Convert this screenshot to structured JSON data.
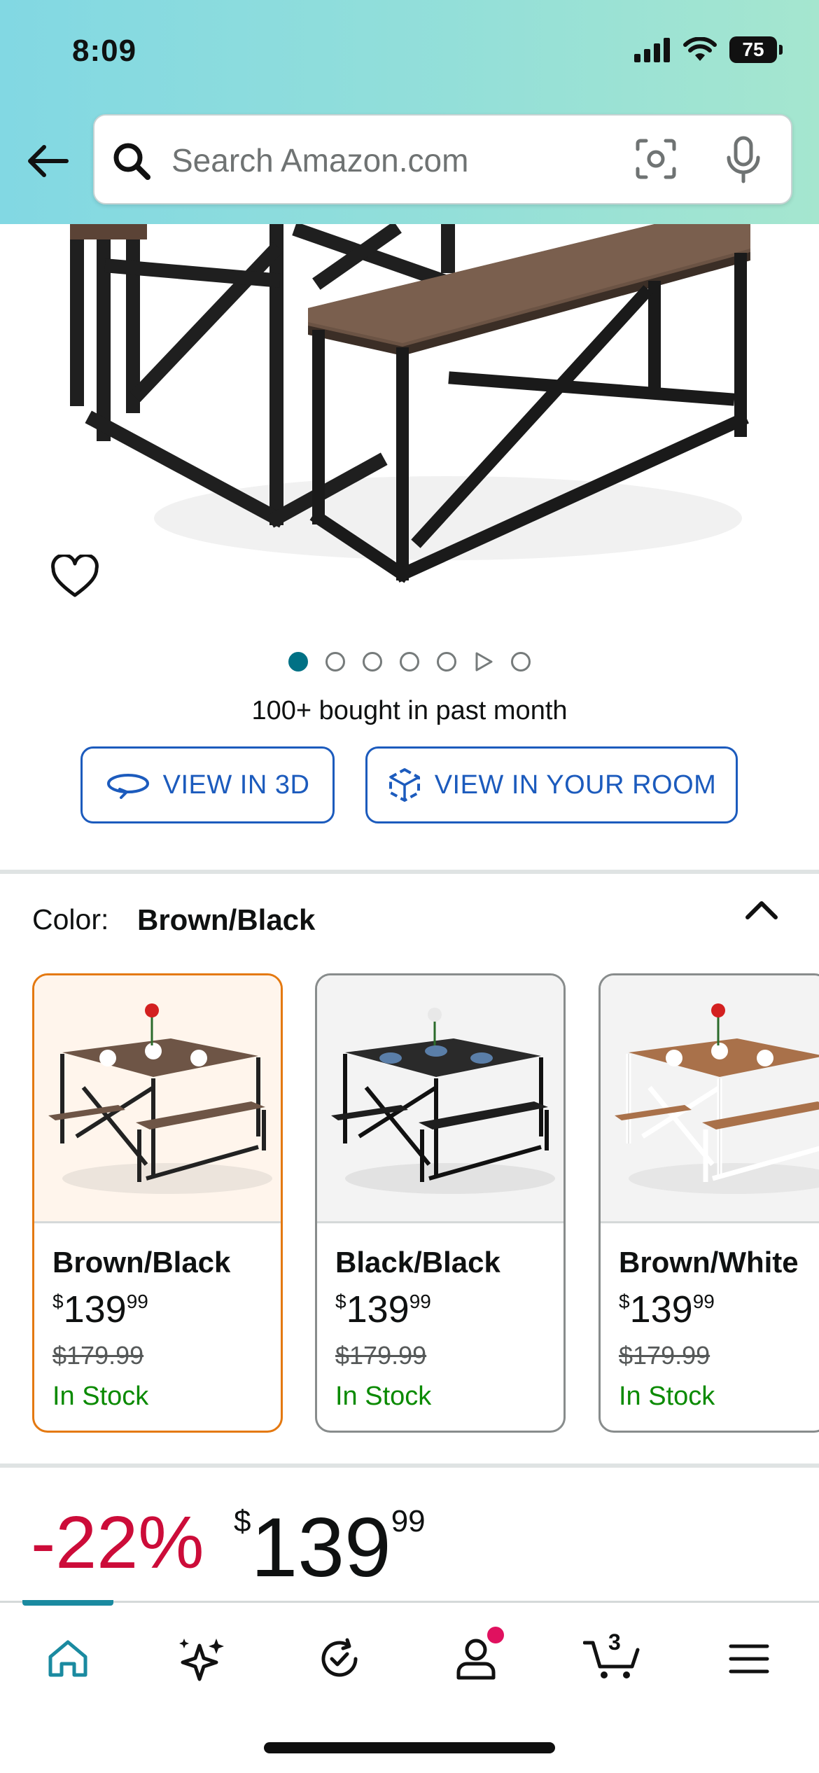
{
  "status_bar": {
    "time": "8:09",
    "battery": "75"
  },
  "search": {
    "placeholder": "Search Amazon.com"
  },
  "carousel": {
    "total_items": 7,
    "active_index": 0,
    "video_index": 5
  },
  "social_proof": "100+ bought in past month",
  "buttons": {
    "view_3d": "VIEW IN 3D",
    "view_room": "VIEW IN YOUR ROOM"
  },
  "color_selector": {
    "label": "Color:",
    "selected": "Brown/Black",
    "variants": [
      {
        "name": "Brown/Black",
        "price_dollars": "139",
        "price_cents": "99",
        "currency": "$",
        "list_price": "$179.99",
        "stock": "In Stock"
      },
      {
        "name": "Black/Black",
        "price_dollars": "139",
        "price_cents": "99",
        "currency": "$",
        "list_price": "$179.99",
        "stock": "In Stock"
      },
      {
        "name": "Brown/White",
        "price_dollars": "139",
        "price_cents": "99",
        "currency": "$",
        "list_price": "$179.99",
        "stock": "In Stock"
      }
    ]
  },
  "price": {
    "discount": "-22%",
    "currency": "$",
    "dollars": "139",
    "cents": "99"
  },
  "bottom_nav": {
    "cart_count": "3",
    "active": "home"
  },
  "colors": {
    "accent_teal": "#007185",
    "link_blue": "#1c5bbd",
    "deal_red": "#cc0c39",
    "stock_green": "#0a8a00",
    "selected_orange": "#e47911"
  }
}
